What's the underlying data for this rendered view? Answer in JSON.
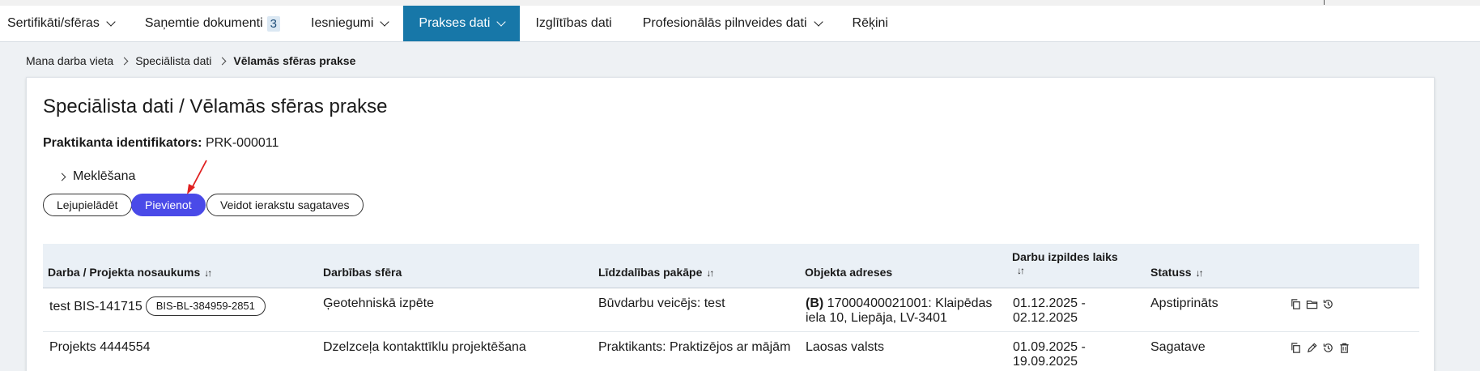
{
  "nav": {
    "items": [
      {
        "label": "Sertifikāti/sfēras",
        "dropdown": true
      },
      {
        "label": "Saņemtie dokumenti",
        "count": "3"
      },
      {
        "label": "Iesniegumi",
        "dropdown": true
      },
      {
        "label": "Prakses dati",
        "dropdown": true,
        "active": true
      },
      {
        "label": "Izglītības dati"
      },
      {
        "label": "Profesionālās pilnveides dati",
        "dropdown": true
      },
      {
        "label": "Rēķini"
      }
    ]
  },
  "breadcrumb": [
    "Mana darba vieta",
    "Speciālista dati",
    "Vēlamās sfēras prakse"
  ],
  "page": {
    "title": "Speciālista dati / Vēlamās sfēras prakse",
    "identifier_label": "Praktikanta identifikators:",
    "identifier_value": "PRK-000011",
    "search_label": "Meklēšana"
  },
  "buttons": {
    "download": "Lejupielādēt",
    "add": "Pievienot",
    "create_draft": "Veidot ierakstu sagataves"
  },
  "table": {
    "headers": {
      "name": "Darba / Projekta nosaukums",
      "sphere": "Darbības sfēra",
      "participation": "Līdzdalības pakāpe",
      "address": "Objekta adreses",
      "period": "Darbu izpildes laiks",
      "status": "Statuss"
    },
    "sort_glyph": "↓↑",
    "rows": [
      {
        "name": "test BIS-141715",
        "badge": "BIS-BL-384959-2851",
        "sphere": "Ģeotehniskā izpēte",
        "participation": "Būvdarbu veicējs: test",
        "address_prefix": "(B)",
        "address": "17000400021001: Klaipēdas iela 10, Liepāja, LV-3401",
        "period_line1": "01.12.2025 -",
        "period_line2": "02.12.2025",
        "status": "Apstiprināts",
        "actions": [
          "copy-icon",
          "folder-icon",
          "history-icon"
        ]
      },
      {
        "name": "Projekts 4444554",
        "badge": "",
        "sphere": "Dzelzceļa kontakttīklu projektēšana",
        "participation": "Praktikants: Praktizējos ar mājām",
        "address_prefix": "",
        "address": "Laosas valsts",
        "period_line1": "01.09.2025 -",
        "period_line2": "19.09.2025",
        "status": "Sagatave",
        "actions": [
          "copy-icon",
          "edit-icon",
          "history-icon",
          "trash-icon"
        ]
      }
    ]
  },
  "colors": {
    "active_nav": "#1777a8",
    "primary_button": "#4a4ae8",
    "annotation_arrow": "#e02020",
    "table_header_bg": "#eaf0f6"
  }
}
